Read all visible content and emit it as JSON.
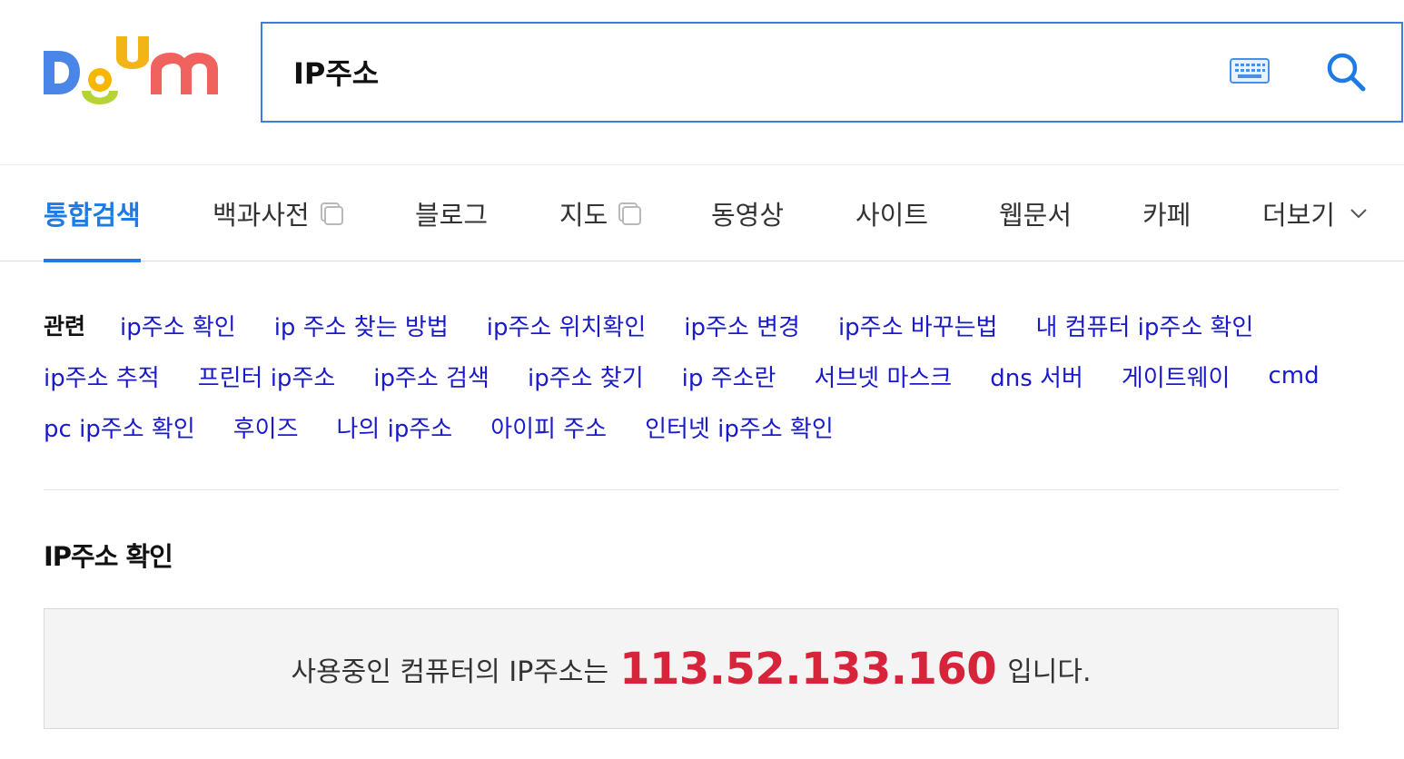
{
  "brand": {
    "logo_text": "Daum",
    "colors": {
      "letter_d": "#4a86e8",
      "letter_a_circle": "#f6b700",
      "letter_a_arc": "#b5d334",
      "letter_u": "#f3b418",
      "letter_m": "#f0625e",
      "accent": "#1e7be6",
      "ip_highlight": "#d8243a"
    }
  },
  "search": {
    "query": "IP주소",
    "keyboard_icon": "keyboard-icon",
    "search_icon": "magnifier-icon"
  },
  "tabs": [
    {
      "label": "통합검색",
      "active": true
    },
    {
      "label": "백과사전",
      "has_popup_icon": true
    },
    {
      "label": "블로그"
    },
    {
      "label": "지도",
      "has_popup_icon": true
    },
    {
      "label": "동영상"
    },
    {
      "label": "사이트"
    },
    {
      "label": "웹문서"
    },
    {
      "label": "카페"
    },
    {
      "label": "더보기",
      "has_chevron": true
    }
  ],
  "related": {
    "title": "관련",
    "rows": [
      [
        "ip주소 확인",
        "ip 주소 찾는 방법",
        "ip주소 위치확인",
        "ip주소 변경",
        "ip주소 바꾸는법",
        "내 컴퓨터 ip주소 확인"
      ],
      [
        "ip주소 추적",
        "프린터 ip주소",
        "ip주소 검색",
        "ip주소 찾기",
        "ip 주소란",
        "서브넷 마스크",
        "dns 서버",
        "게이트웨이",
        "cmd"
      ],
      [
        "pc ip주소 확인",
        "후이즈",
        "나의 ip주소",
        "아이피 주소",
        "인터넷 ip주소 확인"
      ]
    ]
  },
  "ip_section": {
    "title": "IP주소 확인",
    "prefix": "사용중인 컴퓨터의 IP주소는",
    "ip": "113.52.133.160",
    "suffix": "입니다."
  }
}
